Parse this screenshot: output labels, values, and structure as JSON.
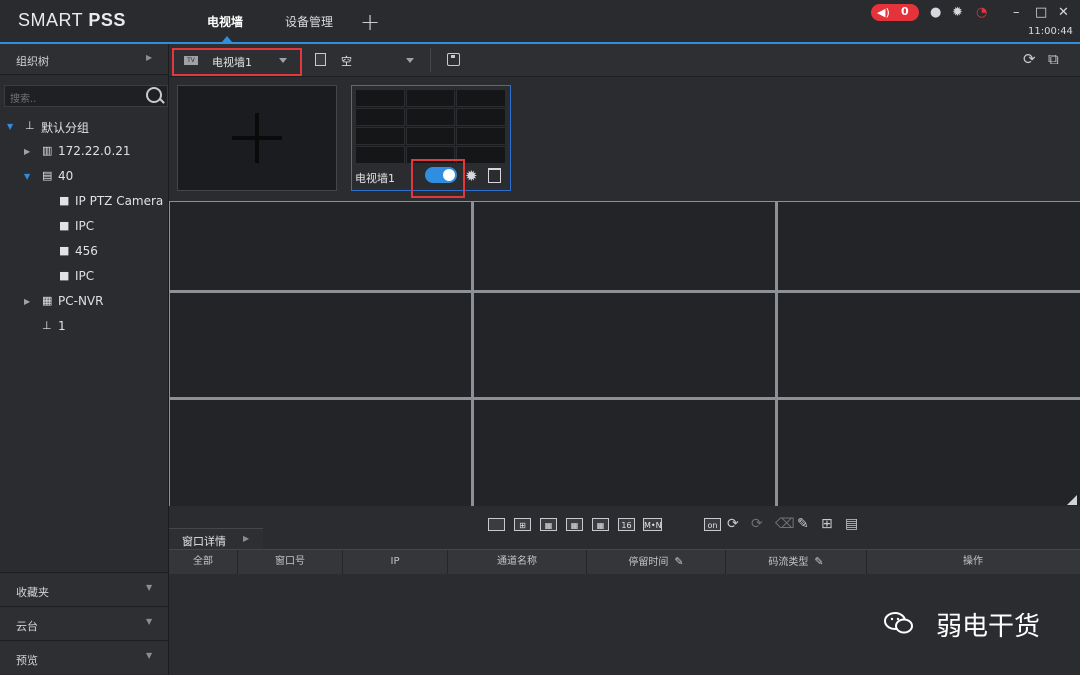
{
  "app": {
    "logo_light": "SMART ",
    "logo_bold": "PSS"
  },
  "tabs": [
    {
      "label": "电视墙",
      "active": true
    },
    {
      "label": "设备管理",
      "active": false
    }
  ],
  "add_tab_icon": "+",
  "topbar": {
    "alarm_count": "0",
    "clock": "11:00:44",
    "icons": [
      "speaker-icon",
      "user-icon",
      "gear-icon",
      "gauge-icon",
      "minimize-icon",
      "maximize-icon",
      "close-icon"
    ]
  },
  "sidebar": {
    "title": "组织树",
    "search_placeholder": "搜索..",
    "tree": [
      {
        "label": "默认分组",
        "icon": "org-icon",
        "expanded": true
      },
      {
        "label": "172.22.0.21",
        "icon": "device-icon",
        "expanded": false
      },
      {
        "label": "40",
        "icon": "device-icon",
        "expanded": true
      },
      {
        "label": "IP PTZ Camera",
        "icon": "camera-icon"
      },
      {
        "label": "IPC",
        "icon": "camera-icon"
      },
      {
        "label": "456",
        "icon": "camera-icon"
      },
      {
        "label": "IPC",
        "icon": "camera-icon"
      },
      {
        "label": "PC-NVR",
        "icon": "nvr-icon",
        "expanded": false
      },
      {
        "label": "1",
        "icon": "org-icon"
      }
    ],
    "panels": [
      "收藏夹",
      "云台",
      "预览"
    ]
  },
  "toolbar": {
    "tvwall_select": "电视墙1",
    "tv_badge": "TV",
    "plan_select": "空"
  },
  "walls": [
    {
      "name": "电视墙1",
      "enabled": true
    }
  ],
  "detail": {
    "tab_label": "窗口详情",
    "columns": [
      "全部",
      "窗口号",
      "IP",
      "通道名称",
      "停留时间",
      "码流类型",
      "操作"
    ]
  },
  "layout_buttons": {
    "sixteen": "16",
    "mn": "M•N",
    "on_badge": "on"
  },
  "watermark": {
    "text": "弱电干货"
  },
  "colors": {
    "accent": "#2f8ee0",
    "highlight": "#e0383e",
    "alarm": "#e5333c"
  }
}
